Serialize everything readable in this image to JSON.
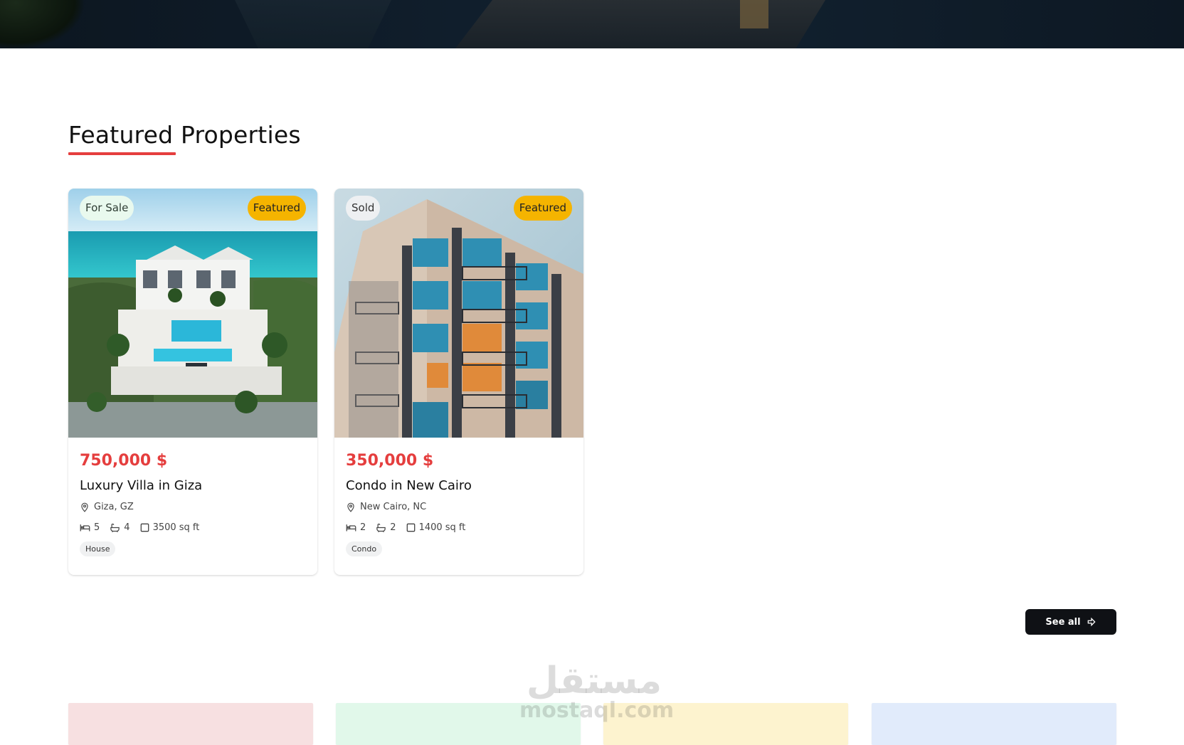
{
  "section": {
    "title": "Featured Properties"
  },
  "properties": [
    {
      "status": "For Sale",
      "featured": "Featured",
      "price": "750,000 $",
      "title": "Luxury Villa in Giza",
      "location": "Giza, GZ",
      "beds": "5",
      "baths": "4",
      "area": "3500 sq ft",
      "type": "House"
    },
    {
      "status": "Sold",
      "featured": "Featured",
      "price": "350,000 $",
      "title": "Condo in New Cairo",
      "location": "New Cairo, NC",
      "beds": "2",
      "baths": "2",
      "area": "1400 sq ft",
      "type": "Condo"
    }
  ],
  "actions": {
    "see_all": "See all"
  },
  "watermark": {
    "arabic": "مستقل",
    "latin": "mostaql.com"
  },
  "colors": {
    "accent": "#e53e3e",
    "featured_badge": "#f5b400",
    "button_dark": "#0f1115",
    "bottom_cards": [
      "#f7e0e1",
      "#e1f8ea",
      "#fdf3cf",
      "#e1ebfb"
    ]
  },
  "icons": {
    "location": "map-pin-icon",
    "beds": "bed-icon",
    "baths": "bath-icon",
    "area": "square-icon",
    "see_all": "arrow-right-icon"
  }
}
